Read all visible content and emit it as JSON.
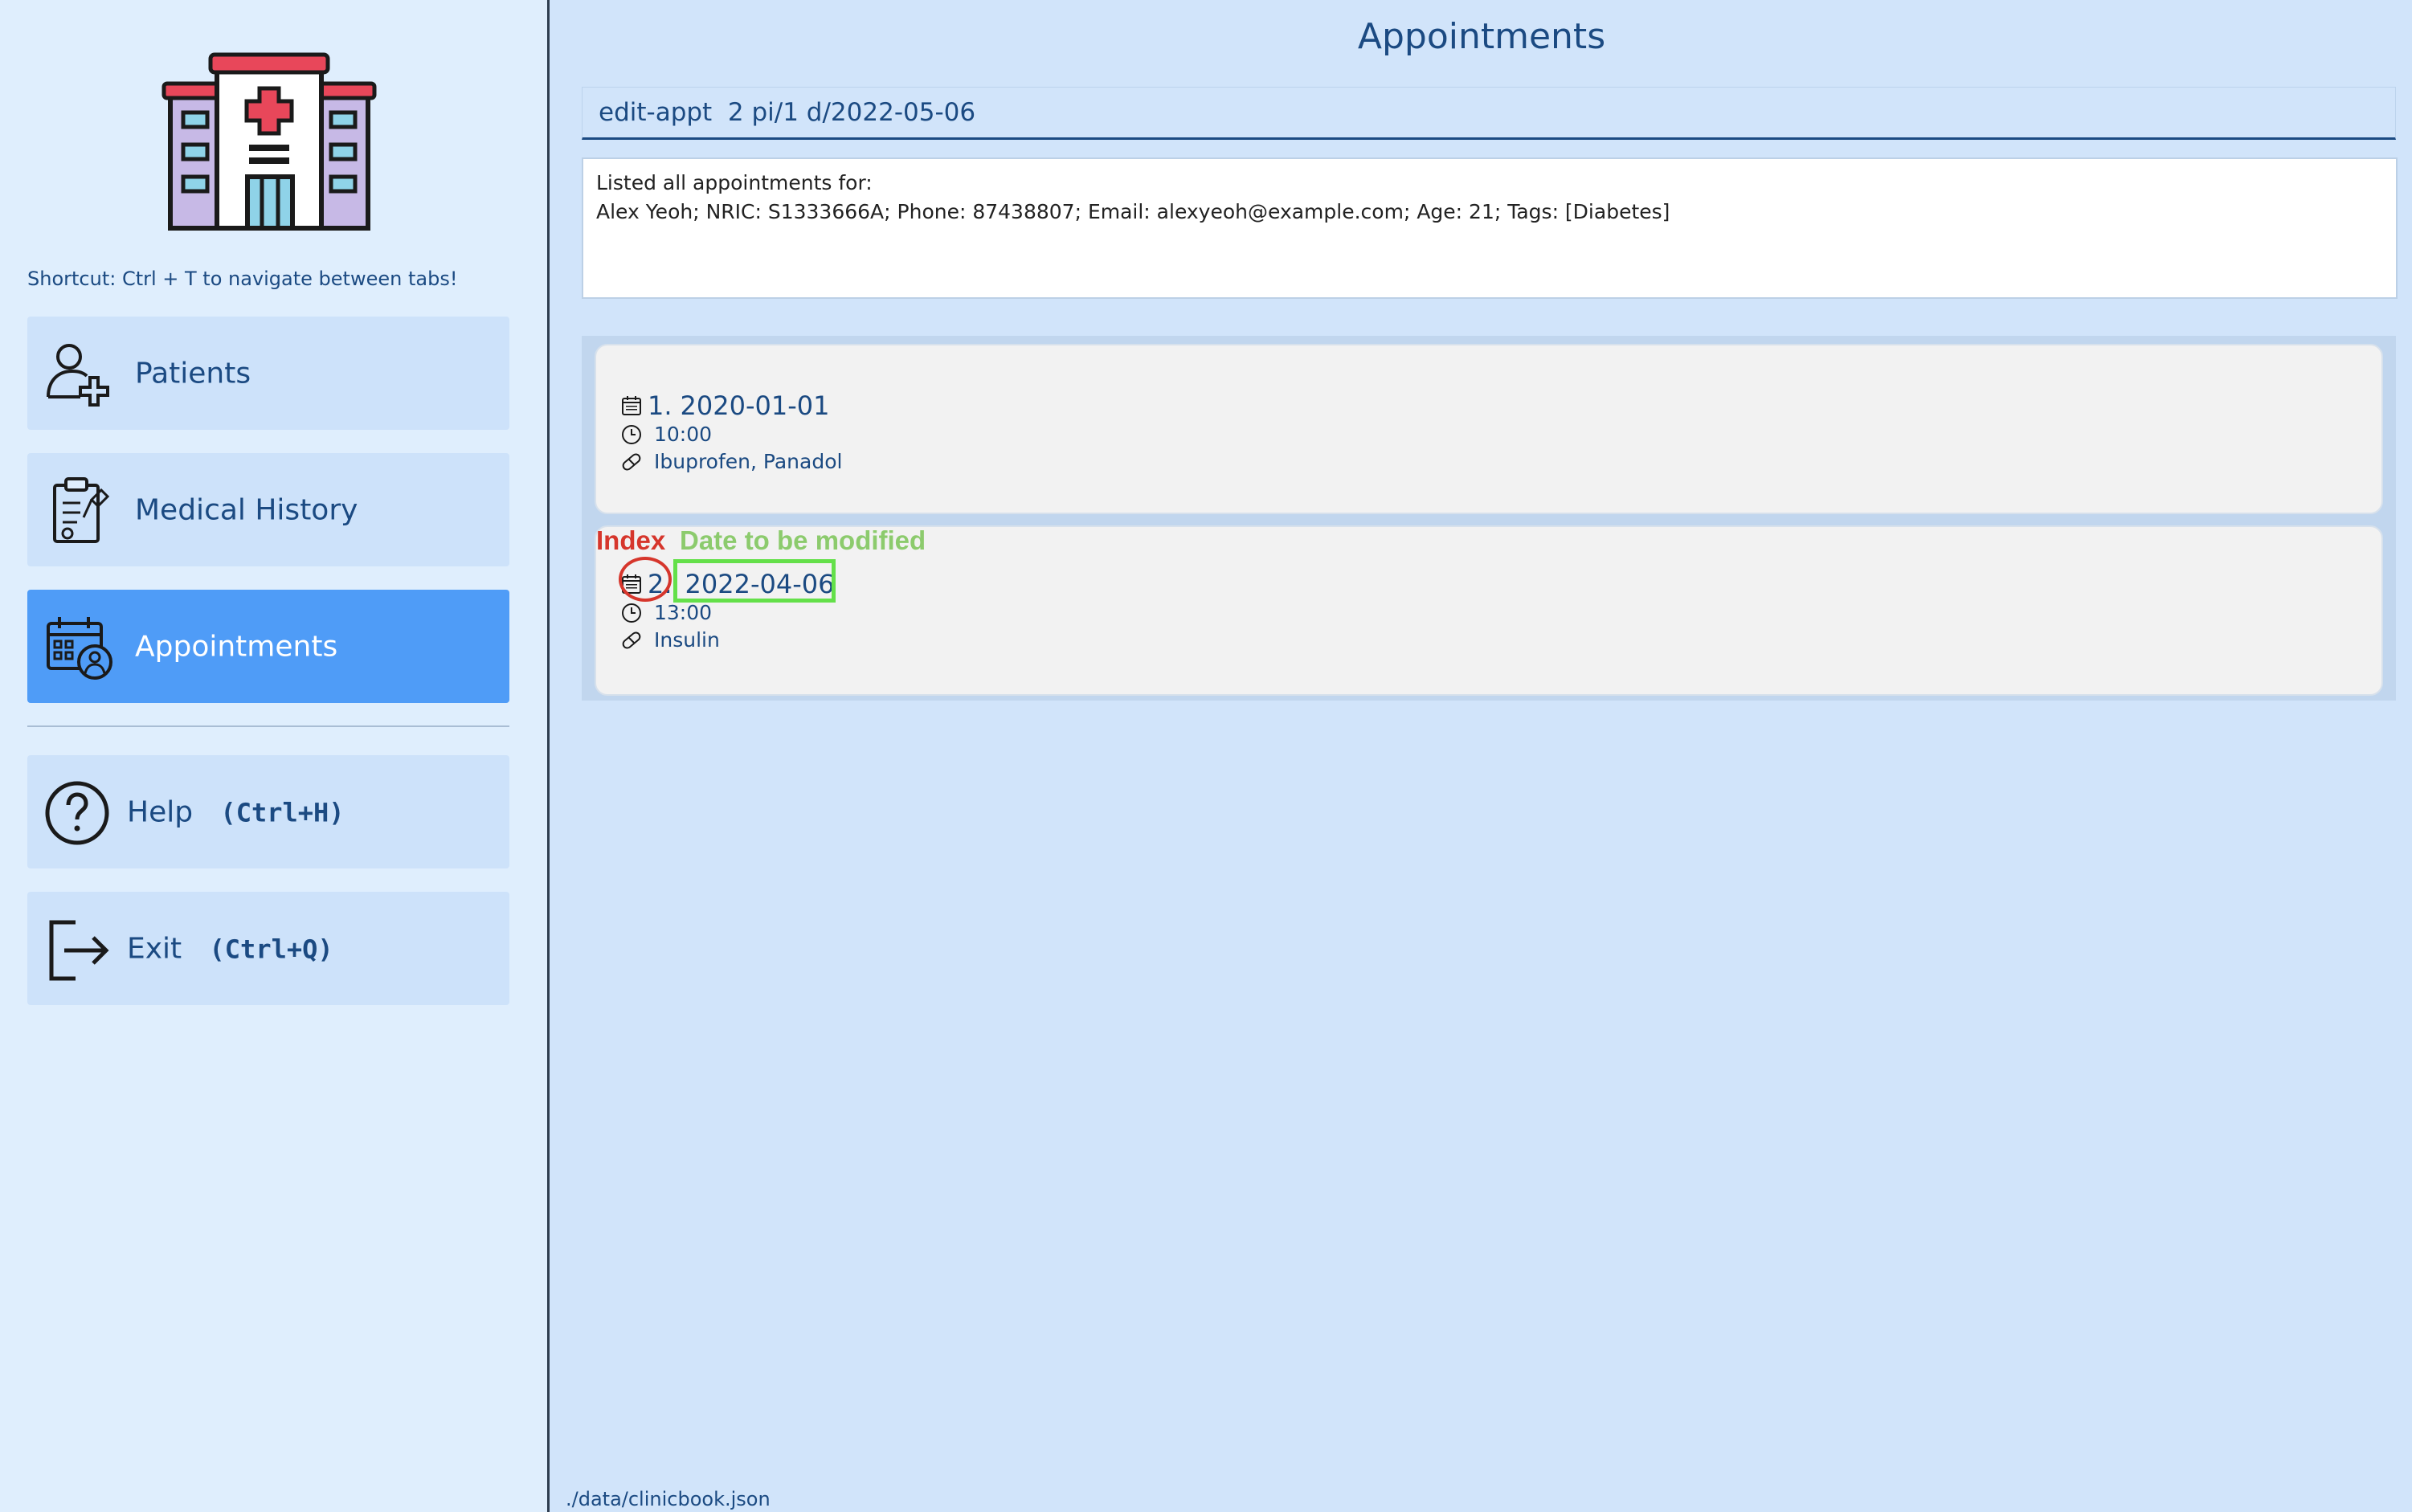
{
  "sidebar": {
    "shortcut_text": "Shortcut: Ctrl + T to navigate between tabs!",
    "nav": {
      "patients": "Patients",
      "medical_history": "Medical History",
      "appointments": "Appointments"
    },
    "help": {
      "label": "Help",
      "shortcut": "(Ctrl+H)"
    },
    "exit": {
      "label": "Exit",
      "shortcut": "(Ctrl+Q)"
    },
    "active_tab": "appointments",
    "active_color": "#4f9cf7"
  },
  "main": {
    "title": "Appointments",
    "command_value": "edit-appt  2 pi/1 d/2022-05-06",
    "result_line1": "Listed all appointments for:",
    "result_line2": "Alex Yeoh; NRIC: S1333666A; Phone: 87438807; Email: alexyeoh@example.com; Age: 21; Tags: [Diabetes]"
  },
  "appointments": [
    {
      "index": "1.",
      "date": "2020-01-01",
      "time": "10:00",
      "medication": "Ibuprofen, Panadol"
    },
    {
      "index": "2.",
      "date": "2022-04-06",
      "time": "13:00",
      "medication": "Insulin"
    }
  ],
  "annotations": {
    "index_label": "Index",
    "date_label": "Date to be modified",
    "index_color": "#d6362c",
    "date_color": "#8ccb6d"
  },
  "status": {
    "file_path": "./data/clinicbook.json"
  }
}
